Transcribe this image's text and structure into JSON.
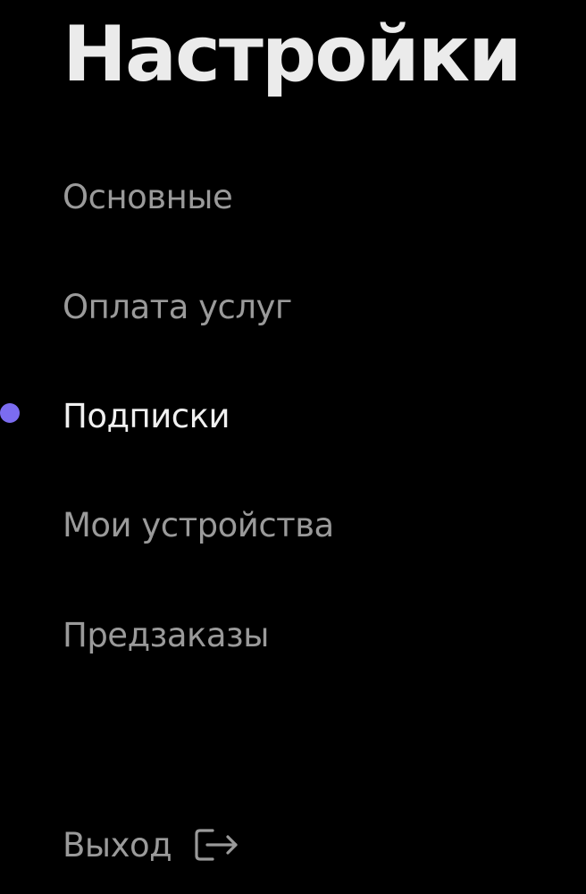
{
  "page": {
    "title": "Настройки"
  },
  "menu": {
    "items": [
      {
        "label": "Основные",
        "active": false
      },
      {
        "label": "Оплата услуг",
        "active": false
      },
      {
        "label": "Подписки",
        "active": true
      },
      {
        "label": "Мои устройства",
        "active": false
      },
      {
        "label": "Предзаказы",
        "active": false
      }
    ],
    "active_indicator_color": "#7b6cf0"
  },
  "logout": {
    "label": "Выход",
    "icon": "logout-icon"
  },
  "colors": {
    "background": "#000000",
    "title": "#ebebeb",
    "item_text": "#9a9a9a",
    "item_text_active": "#f0f0f0",
    "accent": "#7b6cf0"
  }
}
